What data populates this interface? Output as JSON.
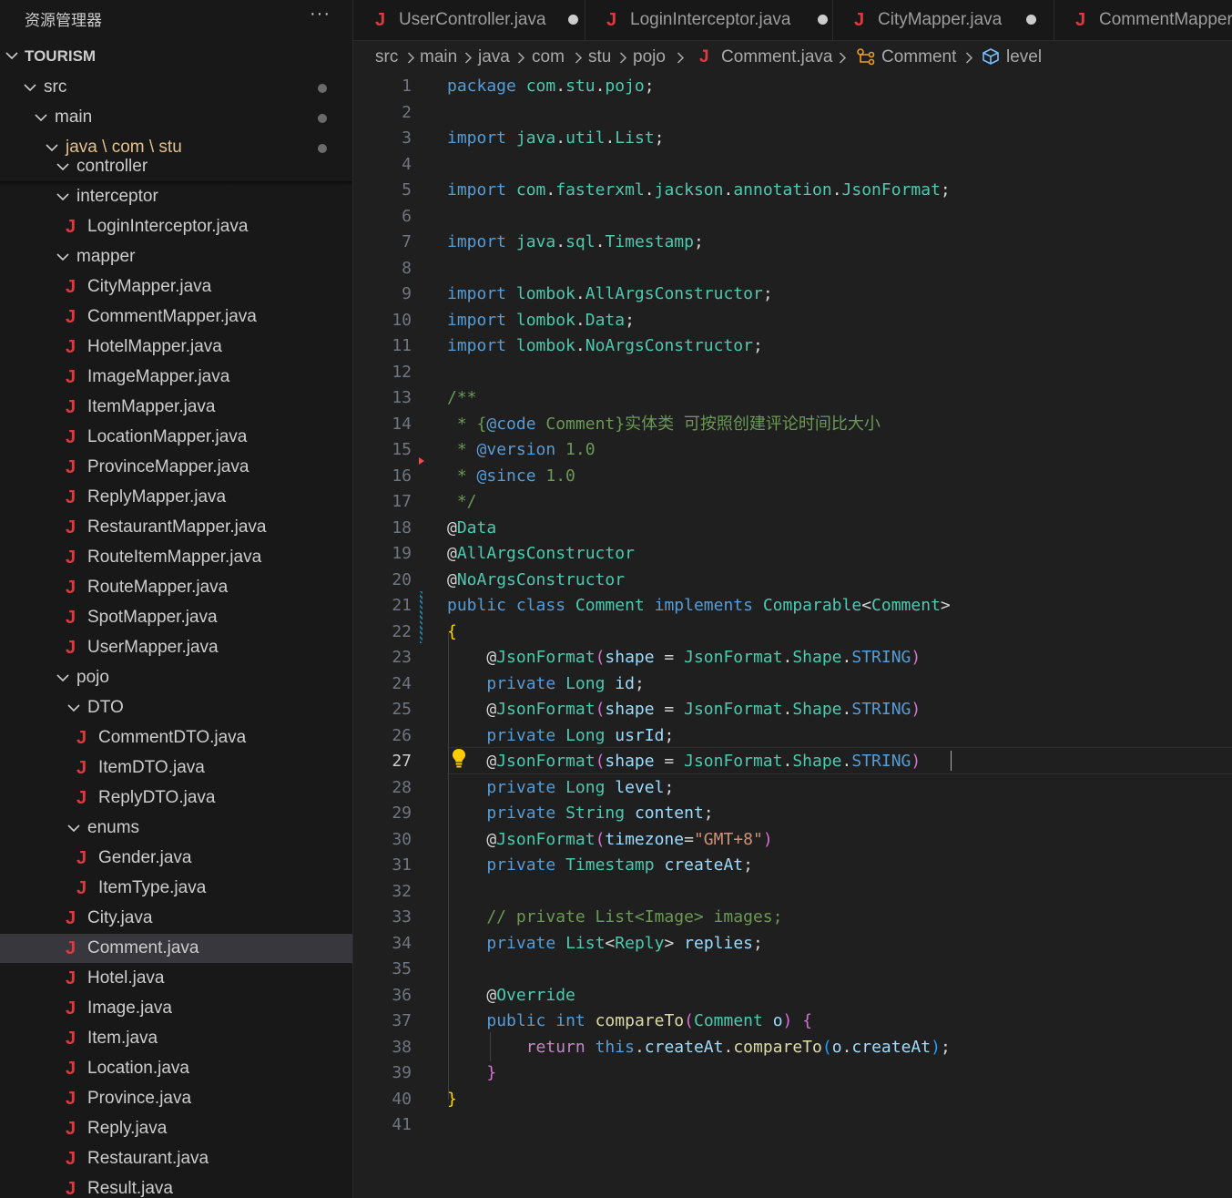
{
  "sidebar": {
    "title": "资源管理器",
    "more": "···",
    "root": "TOURISM",
    "tree": [
      {
        "label": "src",
        "kind": "folder",
        "dot": true
      },
      {
        "label": "main",
        "kind": "folder",
        "dot": true
      },
      {
        "label": "java \\ com \\ stu",
        "kind": "folder",
        "dot": true
      },
      {
        "label": "controller",
        "kind": "folder"
      },
      {
        "label": "interceptor",
        "kind": "folder"
      },
      {
        "label": "LoginInterceptor.java",
        "kind": "file"
      },
      {
        "label": "mapper",
        "kind": "folder"
      },
      {
        "label": "CityMapper.java",
        "kind": "file"
      },
      {
        "label": "CommentMapper.java",
        "kind": "file"
      },
      {
        "label": "HotelMapper.java",
        "kind": "file"
      },
      {
        "label": "ImageMapper.java",
        "kind": "file"
      },
      {
        "label": "ItemMapper.java",
        "kind": "file"
      },
      {
        "label": "LocationMapper.java",
        "kind": "file"
      },
      {
        "label": "ProvinceMapper.java",
        "kind": "file"
      },
      {
        "label": "ReplyMapper.java",
        "kind": "file"
      },
      {
        "label": "RestaurantMapper.java",
        "kind": "file"
      },
      {
        "label": "RouteItemMapper.java",
        "kind": "file"
      },
      {
        "label": "RouteMapper.java",
        "kind": "file"
      },
      {
        "label": "SpotMapper.java",
        "kind": "file"
      },
      {
        "label": "UserMapper.java",
        "kind": "file"
      },
      {
        "label": "pojo",
        "kind": "folder"
      },
      {
        "label": "DTO",
        "kind": "folder"
      },
      {
        "label": "CommentDTO.java",
        "kind": "file"
      },
      {
        "label": "ItemDTO.java",
        "kind": "file"
      },
      {
        "label": "ReplyDTO.java",
        "kind": "file"
      },
      {
        "label": "enums",
        "kind": "folder"
      },
      {
        "label": "Gender.java",
        "kind": "file"
      },
      {
        "label": "ItemType.java",
        "kind": "file"
      },
      {
        "label": "City.java",
        "kind": "file"
      },
      {
        "label": "Comment.java",
        "kind": "file",
        "selected": true
      },
      {
        "label": "Hotel.java",
        "kind": "file"
      },
      {
        "label": "Image.java",
        "kind": "file"
      },
      {
        "label": "Item.java",
        "kind": "file"
      },
      {
        "label": "Location.java",
        "kind": "file"
      },
      {
        "label": "Province.java",
        "kind": "file"
      },
      {
        "label": "Reply.java",
        "kind": "file"
      },
      {
        "label": "Restaurant.java",
        "kind": "file"
      },
      {
        "label": "Result.java",
        "kind": "file"
      }
    ]
  },
  "tabs": [
    {
      "label": "UserController.java",
      "icon": "J",
      "modified": true
    },
    {
      "label": "LoginInterceptor.java",
      "icon": "J",
      "modified": true
    },
    {
      "label": "CityMapper.java",
      "icon": "J",
      "modified": true
    },
    {
      "label": "CommentMapper.java",
      "icon": "J",
      "modified": false
    }
  ],
  "breadcrumb": {
    "parts": [
      "src",
      "main",
      "java",
      "com",
      "stu",
      "pojo"
    ],
    "file": "Comment.java",
    "class_name": "Comment",
    "field": "level"
  },
  "editor": {
    "active_line": 27,
    "lines": [
      [
        [
          "kw",
          "package"
        ],
        [
          "pu",
          " "
        ],
        [
          "ty",
          "com"
        ],
        [
          "pu",
          "."
        ],
        [
          "ty",
          "stu"
        ],
        [
          "pu",
          "."
        ],
        [
          "ty",
          "pojo"
        ],
        [
          "pu",
          ";"
        ]
      ],
      [],
      [
        [
          "kw",
          "import"
        ],
        [
          "pu",
          " "
        ],
        [
          "ty",
          "java"
        ],
        [
          "pu",
          "."
        ],
        [
          "ty",
          "util"
        ],
        [
          "pu",
          "."
        ],
        [
          "ty",
          "List"
        ],
        [
          "pu",
          ";"
        ]
      ],
      [],
      [
        [
          "kw",
          "import"
        ],
        [
          "pu",
          " "
        ],
        [
          "ty",
          "com"
        ],
        [
          "pu",
          "."
        ],
        [
          "ty",
          "fasterxml"
        ],
        [
          "pu",
          "."
        ],
        [
          "ty",
          "jackson"
        ],
        [
          "pu",
          "."
        ],
        [
          "ty",
          "annotation"
        ],
        [
          "pu",
          "."
        ],
        [
          "ty",
          "JsonFormat"
        ],
        [
          "pu",
          ";"
        ]
      ],
      [],
      [
        [
          "kw",
          "import"
        ],
        [
          "pu",
          " "
        ],
        [
          "ty",
          "java"
        ],
        [
          "pu",
          "."
        ],
        [
          "ty",
          "sql"
        ],
        [
          "pu",
          "."
        ],
        [
          "ty",
          "Timestamp"
        ],
        [
          "pu",
          ";"
        ]
      ],
      [],
      [
        [
          "kw",
          "import"
        ],
        [
          "pu",
          " "
        ],
        [
          "ty",
          "lombok"
        ],
        [
          "pu",
          "."
        ],
        [
          "ty",
          "AllArgsConstructor"
        ],
        [
          "pu",
          ";"
        ]
      ],
      [
        [
          "kw",
          "import"
        ],
        [
          "pu",
          " "
        ],
        [
          "ty",
          "lombok"
        ],
        [
          "pu",
          "."
        ],
        [
          "ty",
          "Data"
        ],
        [
          "pu",
          ";"
        ]
      ],
      [
        [
          "kw",
          "import"
        ],
        [
          "pu",
          " "
        ],
        [
          "ty",
          "lombok"
        ],
        [
          "pu",
          "."
        ],
        [
          "ty",
          "NoArgsConstructor"
        ],
        [
          "pu",
          ";"
        ]
      ],
      [],
      [
        [
          "cm",
          "/**"
        ]
      ],
      [
        [
          "cm",
          " * {"
        ],
        [
          "cmk",
          "@code"
        ],
        [
          "cm",
          " Comment}实体类 可按照创建评论时间比大小"
        ]
      ],
      [
        [
          "cm",
          " * "
        ],
        [
          "cmk",
          "@version"
        ],
        [
          "cm",
          " 1.0"
        ]
      ],
      [
        [
          "cm",
          " * "
        ],
        [
          "cmk",
          "@since"
        ],
        [
          "cm",
          " 1.0"
        ]
      ],
      [
        [
          "cm",
          " */"
        ]
      ],
      [
        [
          "pu",
          "@"
        ],
        [
          "ty",
          "Data"
        ]
      ],
      [
        [
          "pu",
          "@"
        ],
        [
          "ty",
          "AllArgsConstructor"
        ]
      ],
      [
        [
          "pu",
          "@"
        ],
        [
          "ty",
          "NoArgsConstructor"
        ]
      ],
      [
        [
          "kw",
          "public"
        ],
        [
          "pu",
          " "
        ],
        [
          "kw",
          "class"
        ],
        [
          "pu",
          " "
        ],
        [
          "ty",
          "Comment"
        ],
        [
          "pu",
          " "
        ],
        [
          "kw",
          "implements"
        ],
        [
          "pu",
          " "
        ],
        [
          "ty",
          "Comparable"
        ],
        [
          "pu",
          "<"
        ],
        [
          "ty",
          "Comment"
        ],
        [
          "pu",
          ">"
        ]
      ],
      [
        [
          "b1",
          "{"
        ]
      ],
      [
        [
          "pu",
          "    @"
        ],
        [
          "ty",
          "JsonFormat"
        ],
        [
          "b2",
          "("
        ],
        [
          "id",
          "shape"
        ],
        [
          "pu",
          " = "
        ],
        [
          "ty",
          "JsonFormat"
        ],
        [
          "pu",
          "."
        ],
        [
          "ty",
          "Shape"
        ],
        [
          "pu",
          "."
        ],
        [
          "kw",
          "STRING"
        ],
        [
          "b2",
          ")"
        ]
      ],
      [
        [
          "pu",
          "    "
        ],
        [
          "kw",
          "private"
        ],
        [
          "pu",
          " "
        ],
        [
          "ty",
          "Long"
        ],
        [
          "pu",
          " "
        ],
        [
          "id",
          "id"
        ],
        [
          "pu",
          ";"
        ]
      ],
      [
        [
          "pu",
          "    @"
        ],
        [
          "ty",
          "JsonFormat"
        ],
        [
          "b2",
          "("
        ],
        [
          "id",
          "shape"
        ],
        [
          "pu",
          " = "
        ],
        [
          "ty",
          "JsonFormat"
        ],
        [
          "pu",
          "."
        ],
        [
          "ty",
          "Shape"
        ],
        [
          "pu",
          "."
        ],
        [
          "kw",
          "STRING"
        ],
        [
          "b2",
          ")"
        ]
      ],
      [
        [
          "pu",
          "    "
        ],
        [
          "kw",
          "private"
        ],
        [
          "pu",
          " "
        ],
        [
          "ty",
          "Long"
        ],
        [
          "pu",
          " "
        ],
        [
          "id",
          "usrId"
        ],
        [
          "pu",
          ";"
        ]
      ],
      [
        [
          "pu",
          "    @"
        ],
        [
          "ty",
          "JsonFormat"
        ],
        [
          "b2",
          "("
        ],
        [
          "id",
          "shape"
        ],
        [
          "pu",
          " = "
        ],
        [
          "ty",
          "JsonFormat"
        ],
        [
          "pu",
          "."
        ],
        [
          "ty",
          "Shape"
        ],
        [
          "pu",
          "."
        ],
        [
          "kw",
          "STRING"
        ],
        [
          "b2",
          ")"
        ]
      ],
      [
        [
          "pu",
          "    "
        ],
        [
          "kw",
          "private"
        ],
        [
          "pu",
          " "
        ],
        [
          "ty",
          "Long"
        ],
        [
          "pu",
          " "
        ],
        [
          "id",
          "level"
        ],
        [
          "pu",
          ";"
        ]
      ],
      [
        [
          "pu",
          "    "
        ],
        [
          "kw",
          "private"
        ],
        [
          "pu",
          " "
        ],
        [
          "ty",
          "String"
        ],
        [
          "pu",
          " "
        ],
        [
          "id",
          "content"
        ],
        [
          "pu",
          ";"
        ]
      ],
      [
        [
          "pu",
          "    @"
        ],
        [
          "ty",
          "JsonFormat"
        ],
        [
          "b2",
          "("
        ],
        [
          "id",
          "timezone"
        ],
        [
          "pu",
          "="
        ],
        [
          "st",
          "\"GMT+8\""
        ],
        [
          "b2",
          ")"
        ]
      ],
      [
        [
          "pu",
          "    "
        ],
        [
          "kw",
          "private"
        ],
        [
          "pu",
          " "
        ],
        [
          "ty",
          "Timestamp"
        ],
        [
          "pu",
          " "
        ],
        [
          "id",
          "createAt"
        ],
        [
          "pu",
          ";"
        ]
      ],
      [],
      [
        [
          "cm",
          "    // private List<Image> images;"
        ]
      ],
      [
        [
          "pu",
          "    "
        ],
        [
          "kw",
          "private"
        ],
        [
          "pu",
          " "
        ],
        [
          "ty",
          "List"
        ],
        [
          "pu",
          "<"
        ],
        [
          "ty",
          "Reply"
        ],
        [
          "pu",
          "> "
        ],
        [
          "id",
          "replies"
        ],
        [
          "pu",
          ";"
        ]
      ],
      [],
      [
        [
          "pu",
          "    @"
        ],
        [
          "ty",
          "Override"
        ]
      ],
      [
        [
          "pu",
          "    "
        ],
        [
          "kw",
          "public"
        ],
        [
          "pu",
          " "
        ],
        [
          "kw",
          "int"
        ],
        [
          "pu",
          " "
        ],
        [
          "fn",
          "compareTo"
        ],
        [
          "b2",
          "("
        ],
        [
          "ty",
          "Comment"
        ],
        [
          "pu",
          " "
        ],
        [
          "id",
          "o"
        ],
        [
          "b2",
          ")"
        ],
        [
          "pu",
          " "
        ],
        [
          "b2",
          "{"
        ]
      ],
      [
        [
          "pu",
          "        "
        ],
        [
          "cf",
          "return"
        ],
        [
          "pu",
          " "
        ],
        [
          "kw",
          "this"
        ],
        [
          "pu",
          "."
        ],
        [
          "id",
          "createAt"
        ],
        [
          "pu",
          "."
        ],
        [
          "fn",
          "compareTo"
        ],
        [
          "b3",
          "("
        ],
        [
          "id",
          "o"
        ],
        [
          "pu",
          "."
        ],
        [
          "id",
          "createAt"
        ],
        [
          "b3",
          ")"
        ],
        [
          "pu",
          ";"
        ]
      ],
      [
        [
          "pu",
          "    "
        ],
        [
          "b2",
          "}"
        ]
      ],
      [
        [
          "b1",
          "}"
        ]
      ],
      []
    ]
  }
}
